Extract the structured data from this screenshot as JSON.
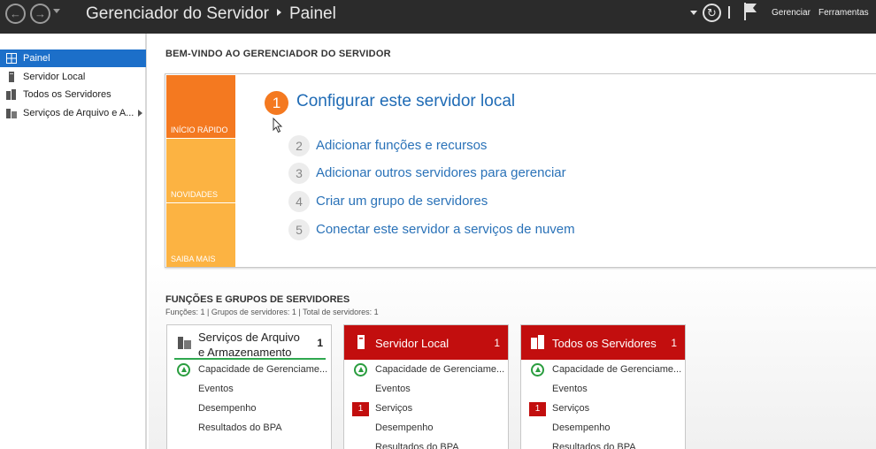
{
  "titlebar": {
    "breadcrumb_app": "Gerenciador do Servidor",
    "breadcrumb_page": "Painel",
    "menu_manage": "Gerenciar",
    "menu_tools": "Ferramentas"
  },
  "sidebar": {
    "items": [
      {
        "label": "Painel",
        "icon": "dashboard-icon",
        "active": true
      },
      {
        "label": "Servidor Local",
        "icon": "server-icon"
      },
      {
        "label": "Todos os Servidores",
        "icon": "servers-icon"
      },
      {
        "label": "Serviços de Arquivo e A...",
        "icon": "file-services-icon"
      }
    ]
  },
  "welcome": {
    "title": "BEM-VINDO AO GERENCIADOR DO SERVIDOR",
    "tiles": [
      "INÍCIO RÁPIDO",
      "NOVIDADES",
      "SAIBA MAIS"
    ],
    "steps": [
      {
        "num": "1",
        "label": "Configurar este servidor local"
      },
      {
        "num": "2",
        "label": "Adicionar funções e recursos"
      },
      {
        "num": "3",
        "label": "Adicionar outros servidores para gerenciar"
      },
      {
        "num": "4",
        "label": "Criar um grupo de servidores"
      },
      {
        "num": "5",
        "label": "Conectar este servidor a serviços de nuvem"
      }
    ]
  },
  "groups": {
    "title": "FUNÇÕES E GRUPOS DE SERVIDORES",
    "counts": "Funções: 1   |   Grupos de servidores: 1   |   Total de servidores: 1",
    "cards": [
      {
        "title": "Serviços de Arquivo e Armazenamento",
        "count": "1",
        "rows": [
          "Capacidade de Gerenciame...",
          "Eventos",
          "Desempenho",
          "Resultados do BPA"
        ]
      },
      {
        "title": "Servidor Local",
        "count": "1",
        "services_badge": "1",
        "rows": [
          "Capacidade de Gerenciame...",
          "Eventos",
          "Serviços",
          "Desempenho",
          "Resultados do BPA"
        ]
      },
      {
        "title": "Todos os Servidores",
        "count": "1",
        "services_badge": "1",
        "rows": [
          "Capacidade de Gerenciame...",
          "Eventos",
          "Serviços",
          "Desempenho",
          "Resultados do BPA"
        ]
      }
    ]
  },
  "colors": {
    "accent_orange": "#f47920",
    "tile_yellow": "#fcb342",
    "sidebar_active": "#1c6fc9",
    "card_red": "#c20e0e",
    "ok_green": "#2a9d3f",
    "link_blue": "#2a72b8"
  }
}
